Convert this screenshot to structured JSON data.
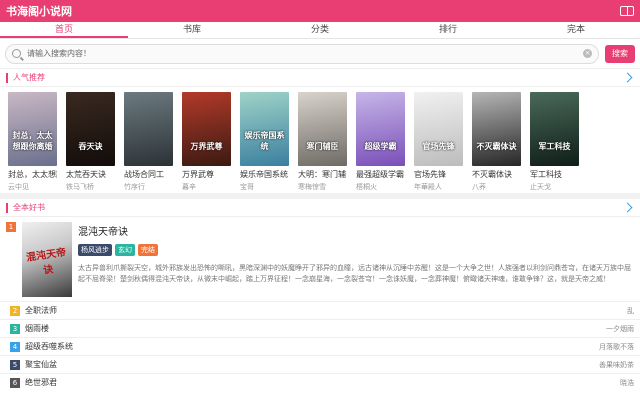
{
  "header": {
    "title": "书海阁小说网",
    "icon": "book-icon"
  },
  "nav": {
    "tabs": [
      "首页",
      "书库",
      "分类",
      "排行",
      "完本"
    ],
    "active": 0
  },
  "search": {
    "placeholder": "请输入搜索内容！",
    "button": "搜索"
  },
  "hot": {
    "label": "人气推荐",
    "books": [
      {
        "name": "封总，太太想跟...",
        "author": "云中见",
        "cover_text": "封总，太太想跟你离婚",
        "colors": [
          "#c9b8c4",
          "#6a6f8d"
        ]
      },
      {
        "name": "太荒吞天诀",
        "author": "铁马飞桥",
        "cover_text": "吞天诀",
        "colors": [
          "#3a2a20",
          "#120c0a"
        ]
      },
      {
        "name": "战场合同工",
        "author": "竹序行",
        "cover_text": "",
        "colors": [
          "#6c7a80",
          "#2b3236"
        ]
      },
      {
        "name": "万界武尊",
        "author": "暮辛",
        "cover_text": "万界武尊",
        "colors": [
          "#b33a2a",
          "#3b1a12"
        ]
      },
      {
        "name": "娱乐帝国系统",
        "author": "宝哥",
        "cover_text": "娱乐帝国系统",
        "colors": [
          "#9fd3c8",
          "#3b7fa0"
        ]
      },
      {
        "name": "大明：寒门辅臣",
        "author": "寒梅惊雪",
        "cover_text": "寒门辅臣",
        "colors": [
          "#d8d4cc",
          "#6e6a64"
        ]
      },
      {
        "name": "最强超级学霸",
        "author": "梧桐火",
        "cover_text": "超级学霸",
        "colors": [
          "#c6b6e8",
          "#7a4fb8"
        ]
      },
      {
        "name": "官场先锋",
        "author": "年華殿人",
        "cover_text": "官场先锋",
        "colors": [
          "#f1f1f1",
          "#bcbcbc"
        ]
      },
      {
        "name": "不灭霸体诀",
        "author": "八荞",
        "cover_text": "不灭霸体诀",
        "colors": [
          "#b6b6b6",
          "#262626"
        ]
      },
      {
        "name": "军工科技",
        "author": "止天戈",
        "cover_text": "军工科技",
        "colors": [
          "#4a6a5a",
          "#0f1e18"
        ]
      }
    ]
  },
  "finished": {
    "label": "全本好书",
    "featured": {
      "rank": "1",
      "title": "混沌天帝诀",
      "cover_text": "混沌天帝诀",
      "tags": [
        {
          "text": "杨风逍步",
          "color": "#3b4a6a"
        },
        {
          "text": "玄幻",
          "color": "#2bb5a0"
        },
        {
          "text": "完结",
          "color": "#f0743a"
        }
      ],
      "desc": "太古异兽利爪撕裂天空，城外邪族发出恐怖的嘶吼，黑暗深渊中的妖魔睁开了邪异的血瞳，远古诸神从沉睡中苏醒！这是一个大争之世！人族强者以利剑问鼎苍穹，在诸天万族中屈起不屈脊梁！楚剑秋偶得混沌天帝诀，从微末中崛起，踏上万界征程！一念崩星海，一念裂苍穹！一念诛妖魔，一念葬神魔！俯瞰诸天神魂，谁敢争锋？这，就是天帝之威！"
    },
    "list": [
      {
        "rank": "2",
        "rank_color": "#f0b428",
        "name": "全职法师",
        "author": "乱"
      },
      {
        "rank": "3",
        "rank_color": "#2bb5a0",
        "name": "烟雨楼",
        "author": "一夕烟雨"
      },
      {
        "rank": "4",
        "rank_color": "#3aa0e8",
        "name": "超级吞噬系统",
        "author": "月落歌不落"
      },
      {
        "rank": "5",
        "rank_color": "#3b4a6a",
        "name": "聚宝仙盆",
        "author": "善果味奶茶"
      },
      {
        "rank": "6",
        "rank_color": "#555555",
        "name": "绝世邪君",
        "author": "晓浩"
      }
    ]
  },
  "colors": {
    "accent": "#e83e73",
    "link": "#3aa0e8"
  }
}
